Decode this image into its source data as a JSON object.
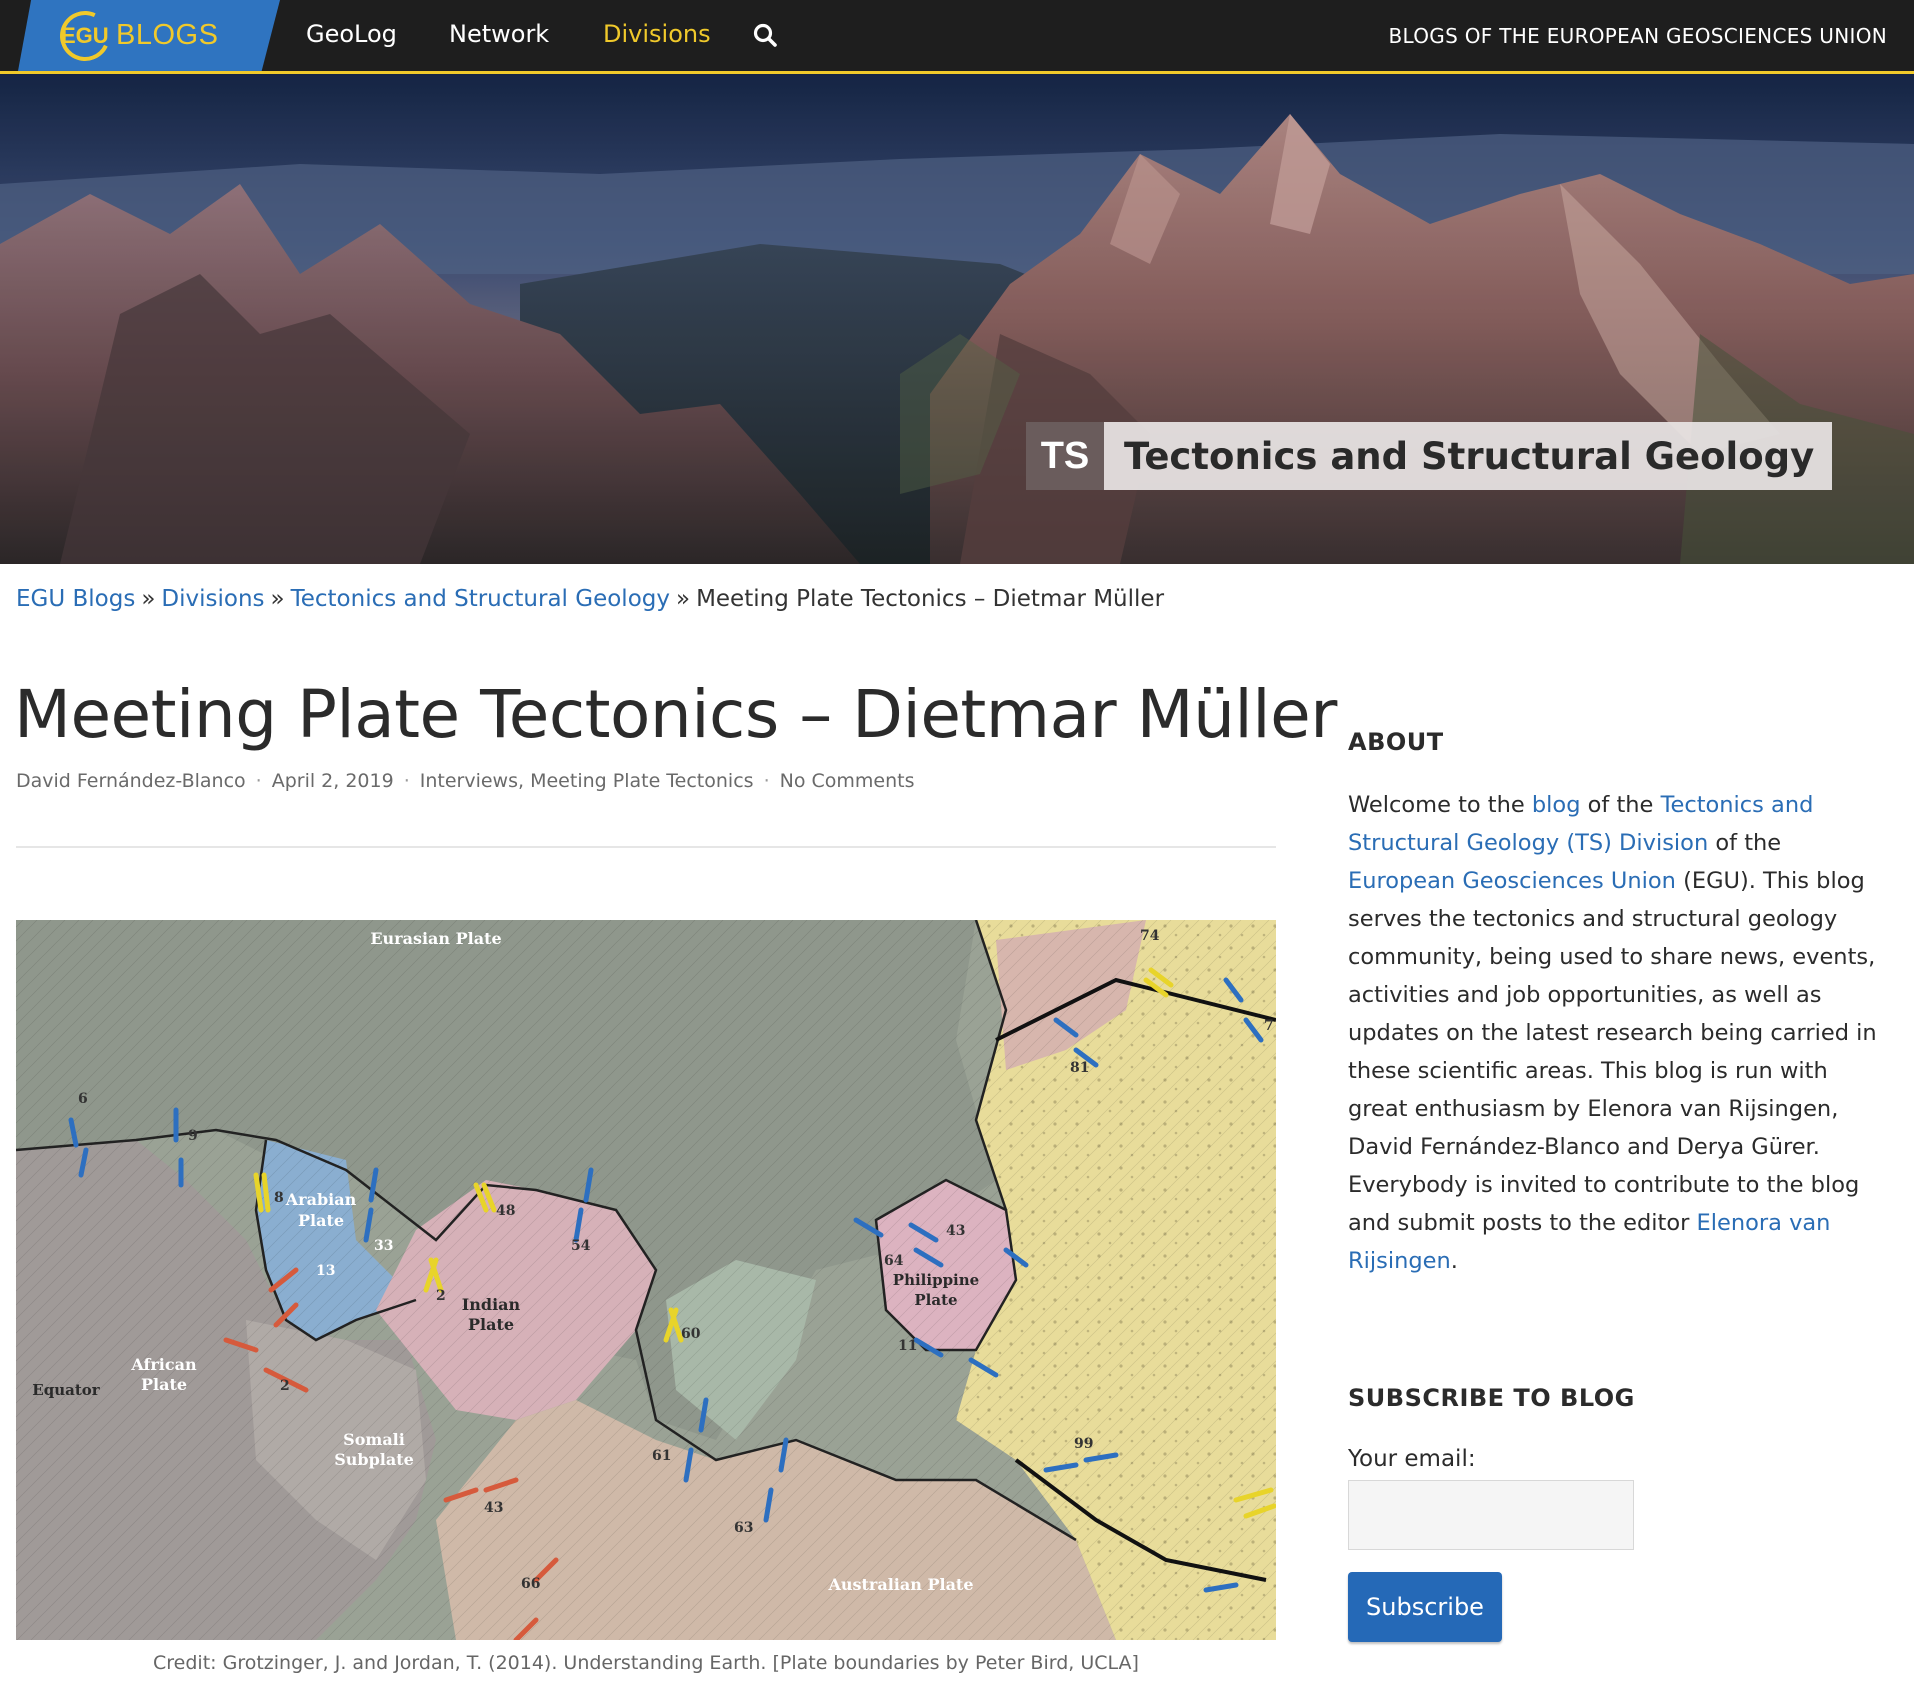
{
  "nav": {
    "logo_mark": "EGU",
    "logo_text": "BLOGS",
    "items": [
      "GeoLog",
      "Network",
      "Divisions"
    ],
    "active_item": "Divisions",
    "search_icon": "search-icon",
    "tagline": "BLOGS OF THE EUROPEAN GEOSCIENCES UNION"
  },
  "hero": {
    "abbr": "TS",
    "title": "Tectonics and Structural Geology"
  },
  "breadcrumb": {
    "items": [
      "EGU Blogs",
      "Divisions",
      "Tectonics and Structural Geology"
    ],
    "current": "Meeting Plate Tectonics – Dietmar Müller",
    "separator": "»"
  },
  "post": {
    "title": "Meeting Plate Tectonics – Dietmar Müller",
    "author": "David Fernández-Blanco",
    "date": "April 2, 2019",
    "category_1": "Interviews",
    "category_2": "Meeting Plate Tectonics",
    "comments": "No Comments",
    "meta_separator": "·"
  },
  "figure": {
    "labels": {
      "eurasian": "Eurasian Plate",
      "arabian_1": "Arabian",
      "arabian_2": "Plate",
      "indian_1": "Indian",
      "indian_2": "Plate",
      "african_1": "African",
      "african_2": "Plate",
      "somali_1": "Somali",
      "somali_2": "Subplate",
      "philippine_1": "Philippine",
      "philippine_2": "Plate",
      "australian": "Australian Plate",
      "equator": "Equator"
    },
    "numbers": [
      "6",
      "9",
      "8",
      "33",
      "13",
      "2",
      "2",
      "48",
      "54",
      "60",
      "61",
      "63",
      "64",
      "43",
      "11",
      "99",
      "81",
      "74",
      "43",
      "66",
      "7"
    ],
    "caption": "Credit: Grotzinger, J. and Jordan, T. (2014). Understanding Earth. [Plate boundaries by Peter Bird, UCLA]"
  },
  "sidebar": {
    "about_heading": "ABOUT",
    "about": {
      "t1": "Welcome to the ",
      "l1": "blog",
      "t2": " of the ",
      "l2": "Tectonics and Structural Geology (TS) Division",
      "t3": " of the ",
      "l3": "European Geosciences Union",
      "t4": " (EGU). This blog serves the tectonics and structural geology community, being used to share news, events, activities and job opportunities, as well as updates on the latest research being carried in these scientific areas. This blog is run with great enthusiasm by Elenora van Rijsingen, David Fernández-Blanco and Derya Gürer. Everybody is invited to contribute to the blog and submit posts to the editor ",
      "l4": "Elenora van Rijsingen",
      "t5": "."
    },
    "subscribe_heading": "SUBSCRIBE TO BLOG",
    "email_label": "Your email:",
    "email_value": "",
    "subscribe_button": "Subscribe"
  },
  "colors": {
    "nav_bg": "#1e1e1e",
    "accent_yellow": "#f0c92b",
    "logo_blue": "#2f74c0",
    "link_blue": "#2a6db5",
    "button_blue": "#2569b7"
  }
}
